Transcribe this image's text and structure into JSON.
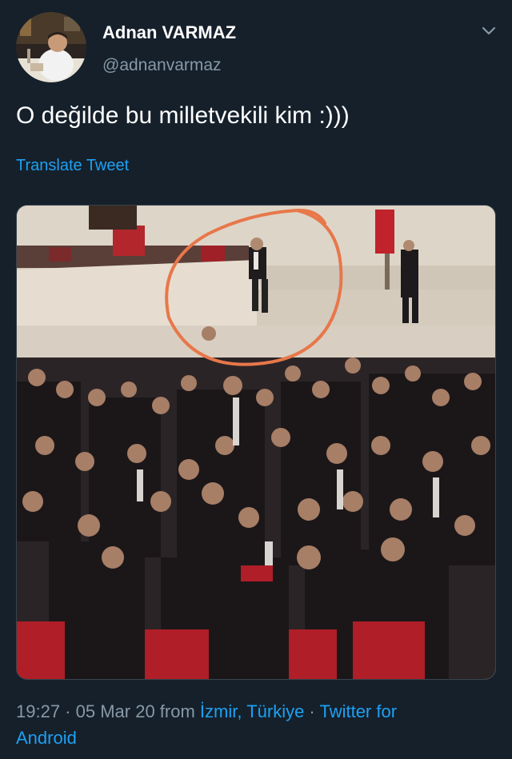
{
  "author": {
    "display_name": "Adnan VARMAZ",
    "handle": "@adnanvarmaz",
    "avatar_icon": "profile-photo"
  },
  "menu": {
    "icon": "chevron-down-icon"
  },
  "tweet": {
    "text": "O değilde bu milletvekili kim :)))",
    "translate_label": "Translate Tweet"
  },
  "media": {
    "type": "photo",
    "annotation": "orange circle highlighting a man standing on the ledge"
  },
  "meta": {
    "time": "19:27",
    "sep1": " · ",
    "date": "05 Mar 20",
    "from_label": " from ",
    "location": "İzmir, Türkiye",
    "sep2": " · ",
    "source_line1": "Twitter for",
    "source_line2": "Android"
  },
  "colors": {
    "background": "#15202b",
    "link": "#1da1f2",
    "secondary_text": "#8899a6",
    "annotation_circle": "#e8774a"
  }
}
